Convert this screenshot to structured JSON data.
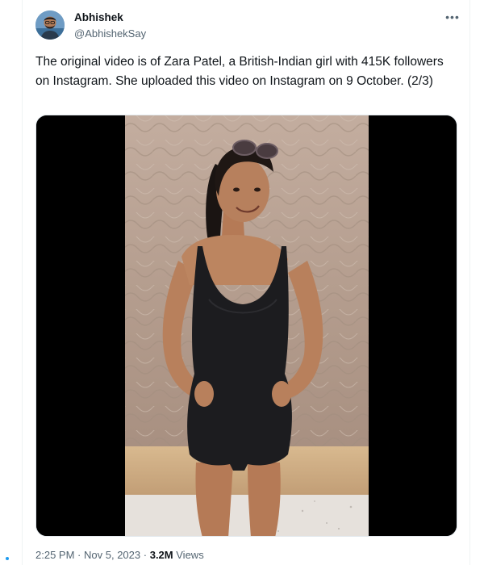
{
  "author": {
    "name": "Abhishek",
    "handle": "@AbhishekSay"
  },
  "more_icon": "more-horizontal-icon",
  "tweet_text": "The original video is of Zara Patel, a British-Indian girl with 415K followers on Instagram. She uploaded this video on Instagram on 9 October. (2/3)",
  "meta": {
    "time": "2:25 PM",
    "separator": "·",
    "date": "Nov 5, 2023",
    "views_count": "3.2M",
    "views_label": "Views"
  },
  "colors": {
    "text": "#0f1419",
    "secondary": "#536471",
    "accent": "#1d9bf0"
  }
}
